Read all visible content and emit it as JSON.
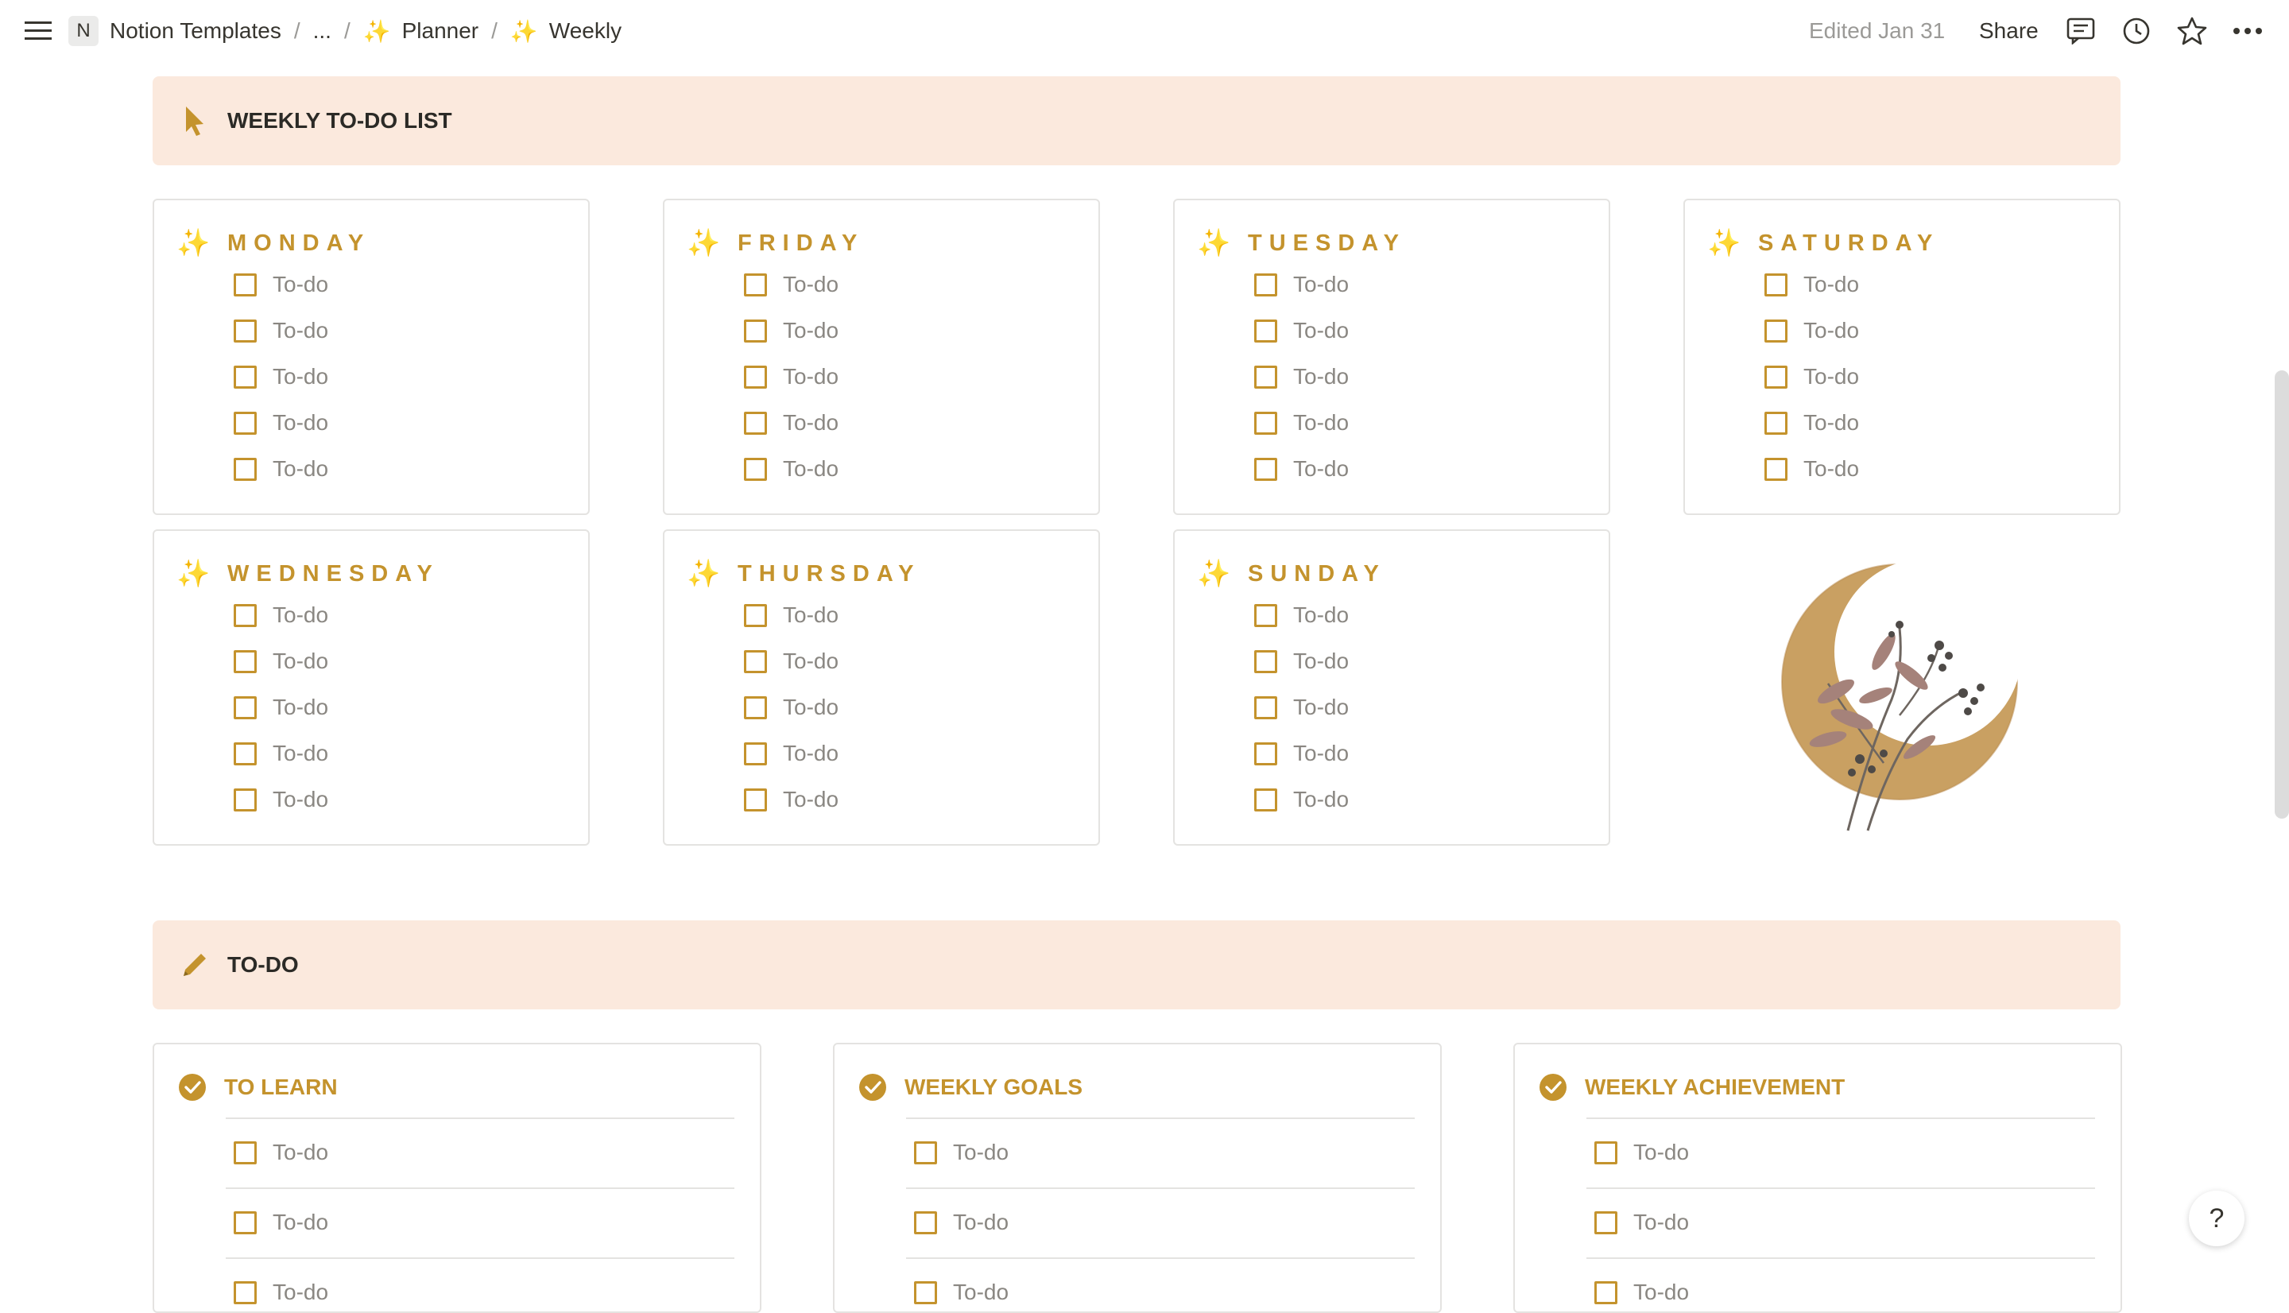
{
  "topbar": {
    "logo_letter": "N",
    "breadcrumbs": [
      "Notion Templates",
      "...",
      "Planner",
      "Weekly"
    ],
    "separator": "/",
    "edited": "Edited Jan 31",
    "share_label": "Share"
  },
  "weekly_callout": {
    "title": "WEEKLY TO-DO LIST"
  },
  "days": [
    {
      "name": "MONDAY",
      "todos": [
        "To-do",
        "To-do",
        "To-do",
        "To-do",
        "To-do"
      ]
    },
    {
      "name": "FRIDAY",
      "todos": [
        "To-do",
        "To-do",
        "To-do",
        "To-do",
        "To-do"
      ]
    },
    {
      "name": "TUESDAY",
      "todos": [
        "To-do",
        "To-do",
        "To-do",
        "To-do",
        "To-do"
      ]
    },
    {
      "name": "SATURDAY",
      "todos": [
        "To-do",
        "To-do",
        "To-do",
        "To-do",
        "To-do"
      ]
    },
    {
      "name": "WEDNESDAY",
      "todos": [
        "To-do",
        "To-do",
        "To-do",
        "To-do",
        "To-do"
      ]
    },
    {
      "name": "THURSDAY",
      "todos": [
        "To-do",
        "To-do",
        "To-do",
        "To-do",
        "To-do"
      ]
    },
    {
      "name": "SUNDAY",
      "todos": [
        "To-do",
        "To-do",
        "To-do",
        "To-do",
        "To-do"
      ]
    }
  ],
  "todo_callout": {
    "title": "TO-DO"
  },
  "lists": [
    {
      "title": "TO LEARN",
      "todos": [
        "To-do",
        "To-do",
        "To-do"
      ]
    },
    {
      "title": "WEEKLY GOALS",
      "todos": [
        "To-do",
        "To-do",
        "To-do"
      ]
    },
    {
      "title": "WEEKLY ACHIEVEMENT",
      "todos": [
        "To-do",
        "To-do",
        "To-do"
      ]
    }
  ],
  "help_label": "?",
  "colors": {
    "accent": "#c4932d",
    "callout_bg": "#fbe9dd",
    "text": "#37352f",
    "muted": "#9b9a97"
  }
}
